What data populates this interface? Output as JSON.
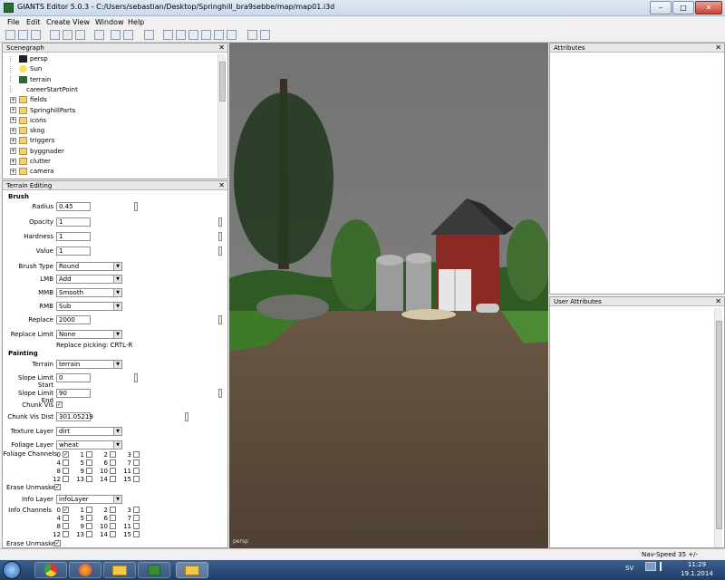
{
  "window": {
    "title": "GIANTS Editor 5.0.3 - C:/Users/sebastian/Desktop/Springhill_bra9sebbe/map/map01.i3d",
    "min": "–",
    "max": "□",
    "close": "✕"
  },
  "menu": [
    "File",
    "Edit",
    "Create",
    "View",
    "Window",
    "Help"
  ],
  "scenegraph": {
    "title": "Scenegraph",
    "items": [
      {
        "label": "persp",
        "icon": "camera-icon",
        "expand": ""
      },
      {
        "label": "Sun",
        "icon": "light-icon",
        "expand": ""
      },
      {
        "label": "terrain",
        "icon": "terrain-icon",
        "expand": ""
      },
      {
        "label": "careerStartPoint",
        "icon": "transform-icon",
        "expand": ""
      },
      {
        "label": "fields",
        "icon": "folder-icon",
        "expand": "+"
      },
      {
        "label": "SpringhillParts",
        "icon": "folder-icon",
        "expand": "+"
      },
      {
        "label": "icons",
        "icon": "folder-icon",
        "expand": "+"
      },
      {
        "label": "skog",
        "icon": "folder-icon",
        "expand": "+"
      },
      {
        "label": "triggers",
        "icon": "folder-icon",
        "expand": "+"
      },
      {
        "label": "byggnader",
        "icon": "folder-icon",
        "expand": "+"
      },
      {
        "label": "clutter",
        "icon": "folder-icon",
        "expand": "+"
      },
      {
        "label": "camera",
        "icon": "folder-icon",
        "expand": "+"
      }
    ]
  },
  "terrain": {
    "title": "Terrain Editing",
    "brush_header": "Brush",
    "radius": {
      "label": "Radius",
      "value": "0.45",
      "pos": 0.05
    },
    "opacity": {
      "label": "Opacity",
      "value": "1",
      "pos": 1.0
    },
    "hardness": {
      "label": "Hardness",
      "value": "1",
      "pos": 1.0
    },
    "value": {
      "label": "Value",
      "value": "1",
      "pos": 1.0
    },
    "brush_type": {
      "label": "Brush Type",
      "value": "Round"
    },
    "lmb": {
      "label": "LMB",
      "value": "Add"
    },
    "mmb": {
      "label": "MMB",
      "value": "Smooth"
    },
    "rmb": {
      "label": "RMB",
      "value": "Sub"
    },
    "replace": {
      "label": "Replace",
      "value": "2000",
      "pos": 1.0
    },
    "replace_limit": {
      "label": "Replace Limit",
      "value": "None"
    },
    "replace_picking": "Replace picking: CRTL-R",
    "painting_header": "Painting",
    "painting_terrain": {
      "label": "Terrain",
      "value": "terrain"
    },
    "slope_start": {
      "label": "Slope Limit Start",
      "value": "0",
      "pos": 0.05
    },
    "slope_end": {
      "label": "Slope Limit End",
      "value": "90",
      "pos": 1.0
    },
    "chunk_vis": {
      "label": "Chunk Vis",
      "checked": true
    },
    "chunk_vis_dist": {
      "label": "Chunk Vis Dist",
      "value": "301.05219",
      "pos": 0.62
    },
    "texture_layer": {
      "label": "Texture Layer",
      "value": "dirt"
    },
    "foliage_layer": {
      "label": "Foliage Layer",
      "value": "wheat"
    },
    "foliage_channels_label": "Foliage Channels",
    "foliage_checked": [
      0
    ],
    "erase_unmasked_1": "Erase Unmasked",
    "info_layer": {
      "label": "Info Layer",
      "value": "infoLayer"
    },
    "info_channels_label": "Info Channels",
    "info_checked": [
      0
    ],
    "erase_unmasked_2": "Erase Unmasked",
    "channel_numbers": [
      "0",
      "1",
      "2",
      "3",
      "4",
      "5",
      "6",
      "7",
      "8",
      "9",
      "10",
      "11",
      "12",
      "13",
      "14",
      "15"
    ]
  },
  "attributes": {
    "title": "Attributes"
  },
  "user_attributes": {
    "title": "User Attributes"
  },
  "viewport": {
    "camera_label": "persp"
  },
  "status": {
    "nav_speed": "Nav-Speed 35 +/-"
  },
  "taskbar": {
    "lang": "SV",
    "time": "11:29",
    "date": "19.1.2014"
  },
  "colors": {
    "barn": "#8b2a22",
    "roof": "#3a3a3a",
    "grass": "#3f7a2a",
    "ground": "#5b4a38",
    "sky": "#6e6e6e"
  }
}
